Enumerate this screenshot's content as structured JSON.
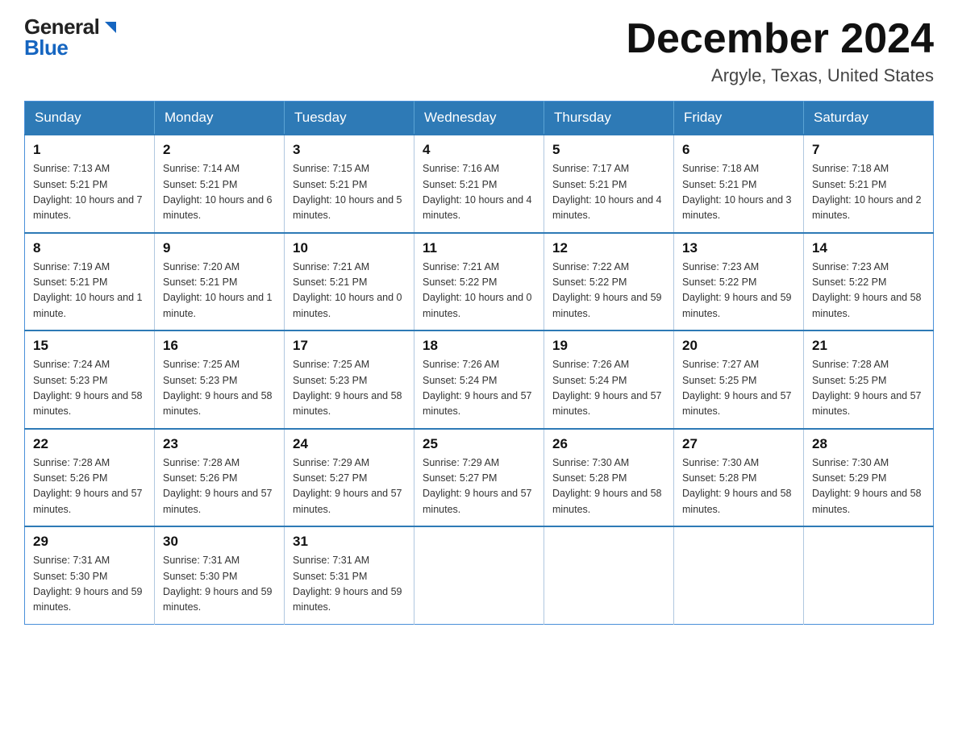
{
  "logo": {
    "general": "General",
    "blue": "Blue"
  },
  "title": {
    "month": "December 2024",
    "location": "Argyle, Texas, United States"
  },
  "weekdays": [
    "Sunday",
    "Monday",
    "Tuesday",
    "Wednesday",
    "Thursday",
    "Friday",
    "Saturday"
  ],
  "weeks": [
    [
      {
        "day": "1",
        "sunrise": "7:13 AM",
        "sunset": "5:21 PM",
        "daylight": "10 hours and 7 minutes."
      },
      {
        "day": "2",
        "sunrise": "7:14 AM",
        "sunset": "5:21 PM",
        "daylight": "10 hours and 6 minutes."
      },
      {
        "day": "3",
        "sunrise": "7:15 AM",
        "sunset": "5:21 PM",
        "daylight": "10 hours and 5 minutes."
      },
      {
        "day": "4",
        "sunrise": "7:16 AM",
        "sunset": "5:21 PM",
        "daylight": "10 hours and 4 minutes."
      },
      {
        "day": "5",
        "sunrise": "7:17 AM",
        "sunset": "5:21 PM",
        "daylight": "10 hours and 4 minutes."
      },
      {
        "day": "6",
        "sunrise": "7:18 AM",
        "sunset": "5:21 PM",
        "daylight": "10 hours and 3 minutes."
      },
      {
        "day": "7",
        "sunrise": "7:18 AM",
        "sunset": "5:21 PM",
        "daylight": "10 hours and 2 minutes."
      }
    ],
    [
      {
        "day": "8",
        "sunrise": "7:19 AM",
        "sunset": "5:21 PM",
        "daylight": "10 hours and 1 minute."
      },
      {
        "day": "9",
        "sunrise": "7:20 AM",
        "sunset": "5:21 PM",
        "daylight": "10 hours and 1 minute."
      },
      {
        "day": "10",
        "sunrise": "7:21 AM",
        "sunset": "5:21 PM",
        "daylight": "10 hours and 0 minutes."
      },
      {
        "day": "11",
        "sunrise": "7:21 AM",
        "sunset": "5:22 PM",
        "daylight": "10 hours and 0 minutes."
      },
      {
        "day": "12",
        "sunrise": "7:22 AM",
        "sunset": "5:22 PM",
        "daylight": "9 hours and 59 minutes."
      },
      {
        "day": "13",
        "sunrise": "7:23 AM",
        "sunset": "5:22 PM",
        "daylight": "9 hours and 59 minutes."
      },
      {
        "day": "14",
        "sunrise": "7:23 AM",
        "sunset": "5:22 PM",
        "daylight": "9 hours and 58 minutes."
      }
    ],
    [
      {
        "day": "15",
        "sunrise": "7:24 AM",
        "sunset": "5:23 PM",
        "daylight": "9 hours and 58 minutes."
      },
      {
        "day": "16",
        "sunrise": "7:25 AM",
        "sunset": "5:23 PM",
        "daylight": "9 hours and 58 minutes."
      },
      {
        "day": "17",
        "sunrise": "7:25 AM",
        "sunset": "5:23 PM",
        "daylight": "9 hours and 58 minutes."
      },
      {
        "day": "18",
        "sunrise": "7:26 AM",
        "sunset": "5:24 PM",
        "daylight": "9 hours and 57 minutes."
      },
      {
        "day": "19",
        "sunrise": "7:26 AM",
        "sunset": "5:24 PM",
        "daylight": "9 hours and 57 minutes."
      },
      {
        "day": "20",
        "sunrise": "7:27 AM",
        "sunset": "5:25 PM",
        "daylight": "9 hours and 57 minutes."
      },
      {
        "day": "21",
        "sunrise": "7:28 AM",
        "sunset": "5:25 PM",
        "daylight": "9 hours and 57 minutes."
      }
    ],
    [
      {
        "day": "22",
        "sunrise": "7:28 AM",
        "sunset": "5:26 PM",
        "daylight": "9 hours and 57 minutes."
      },
      {
        "day": "23",
        "sunrise": "7:28 AM",
        "sunset": "5:26 PM",
        "daylight": "9 hours and 57 minutes."
      },
      {
        "day": "24",
        "sunrise": "7:29 AM",
        "sunset": "5:27 PM",
        "daylight": "9 hours and 57 minutes."
      },
      {
        "day": "25",
        "sunrise": "7:29 AM",
        "sunset": "5:27 PM",
        "daylight": "9 hours and 57 minutes."
      },
      {
        "day": "26",
        "sunrise": "7:30 AM",
        "sunset": "5:28 PM",
        "daylight": "9 hours and 58 minutes."
      },
      {
        "day": "27",
        "sunrise": "7:30 AM",
        "sunset": "5:28 PM",
        "daylight": "9 hours and 58 minutes."
      },
      {
        "day": "28",
        "sunrise": "7:30 AM",
        "sunset": "5:29 PM",
        "daylight": "9 hours and 58 minutes."
      }
    ],
    [
      {
        "day": "29",
        "sunrise": "7:31 AM",
        "sunset": "5:30 PM",
        "daylight": "9 hours and 59 minutes."
      },
      {
        "day": "30",
        "sunrise": "7:31 AM",
        "sunset": "5:30 PM",
        "daylight": "9 hours and 59 minutes."
      },
      {
        "day": "31",
        "sunrise": "7:31 AM",
        "sunset": "5:31 PM",
        "daylight": "9 hours and 59 minutes."
      },
      null,
      null,
      null,
      null
    ]
  ],
  "labels": {
    "sunrise": "Sunrise: ",
    "sunset": "Sunset: ",
    "daylight": "Daylight: "
  }
}
